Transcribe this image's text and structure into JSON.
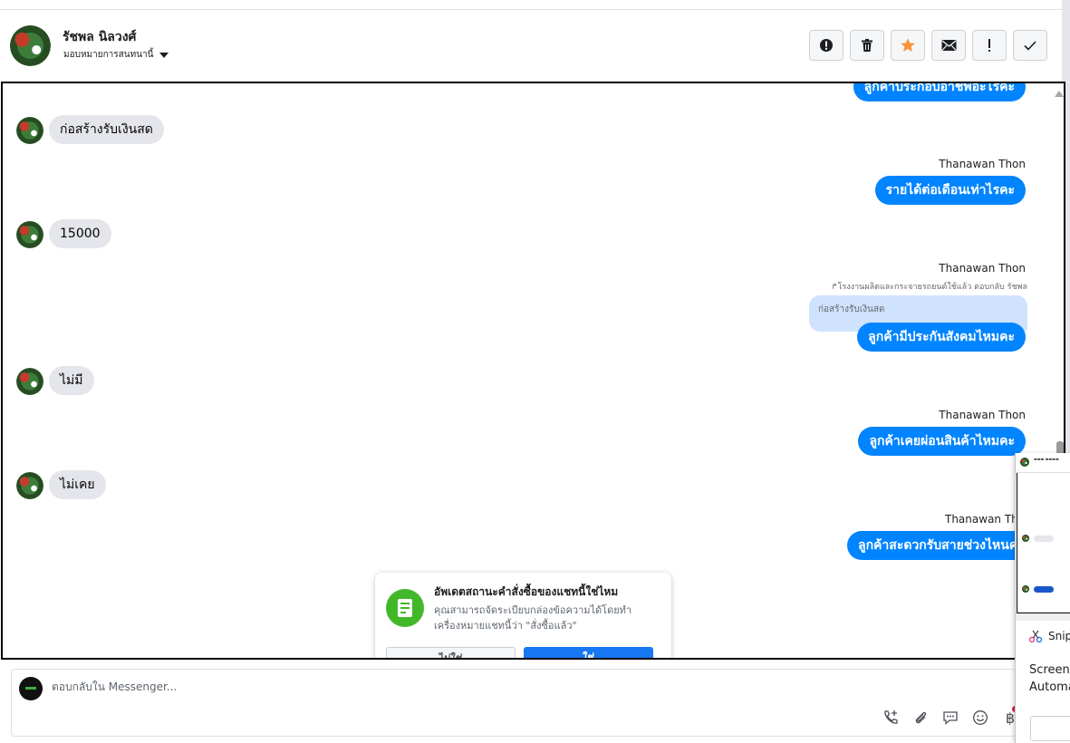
{
  "header": {
    "name": "รัชพล นิลวงศ์",
    "assign_label": "มอบหมายการสนทนานี้"
  },
  "actions": [
    {
      "name": "spam-button",
      "icon": "alert-circle-icon"
    },
    {
      "name": "delete-button",
      "icon": "trash-icon"
    },
    {
      "name": "star-button",
      "icon": "star-icon"
    },
    {
      "name": "mark-unread-button",
      "icon": "envelope-icon"
    },
    {
      "name": "important-button",
      "icon": "exclamation-icon"
    },
    {
      "name": "done-button",
      "icon": "checkmark-icon"
    }
  ],
  "colors": {
    "outgoing_bubble": "#0084ff",
    "incoming_bubble": "#e4e6eb",
    "star": "#f7923b",
    "popup_primary": "#1877f2",
    "popup_icon": "#42b72a"
  },
  "messages": {
    "m1_out": "ลูกค้าประกอบอาชีพอะไรคะ",
    "m2_in": "ก่อสร้างรับเงินสด",
    "m3_sender": "Thanawan Thon",
    "m3_out": "รายได้ต่อเดือนเท่าไรคะ",
    "m4_in": "15000",
    "m5_sender": "Thanawan Thon",
    "m5_replied": "โรงงานผลิตและกระจายรถยนต์ใช้แล้ว ตอบกลับ รัชพล",
    "m5_quote": "ก่อสร้างรับเงินสด",
    "m5_out": "ลูกค้ามีประกันสังคมไหมคะ",
    "m6_in": "ไม่มี",
    "m7_sender": "Thanawan Thon",
    "m7_out": "ลูกค้าเคยผ่อนสินค้าไหมคะ",
    "m8_in": "ไม่เคย",
    "m9_sender": "Thanawan Thon",
    "m9_out": "ลูกค้าสะดวกรับสายช่วงไหนคะ"
  },
  "popup": {
    "title": "อัพเดตสถานะคำสั่งซื้อของแชทนี้ใช่ไหม",
    "body": "คุณสามารถจัดระเบียบกล่องข้อความได้โดยทำเครื่องหมายแชทนี้ว่า \"สั่งซื้อแล้ว\"",
    "no_label": "ไม่ใช่",
    "yes_label": "ใช่"
  },
  "composer": {
    "placeholder": "ตอบกลับใน Messenger..."
  },
  "composer_icons": [
    "phone-add-icon",
    "paperclip-icon",
    "chat-bubble-icon",
    "smiley-icon",
    "baht-icon"
  ],
  "snip": {
    "label": "Snip",
    "text_line1": "Screens",
    "text_line2": "Automa"
  }
}
